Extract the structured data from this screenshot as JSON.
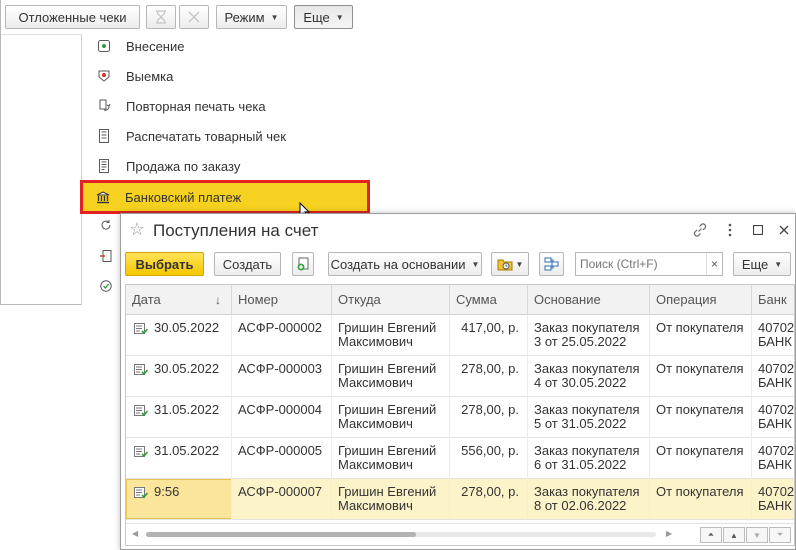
{
  "back_window": {
    "toolbar": {
      "deferred_checks": "Отложенные чеки",
      "mode": "Режим",
      "more": "Еще"
    },
    "menu": {
      "items": [
        {
          "label": "Внесение",
          "icon": "cash-in-icon"
        },
        {
          "label": "Выемка",
          "icon": "cash-out-icon"
        },
        {
          "label": "Повторная печать чека",
          "icon": "reprint-icon"
        },
        {
          "label": "Распечатать товарный чек",
          "icon": "receipt-icon"
        },
        {
          "label": "Продажа по заказу",
          "icon": "order-sale-icon"
        },
        {
          "label": "Банковский платеж",
          "icon": "bank-icon",
          "highlighted": true
        }
      ]
    }
  },
  "front_window": {
    "title": "Поступления на счет",
    "toolbar": {
      "select": "Выбрать",
      "create": "Создать",
      "create_based_on": "Создать на основании",
      "search_placeholder": "Поиск (Ctrl+F)",
      "search_clear": "×",
      "more": "Еще"
    },
    "table": {
      "columns": [
        "Дата",
        "Номер",
        "Откуда",
        "Сумма",
        "Основание",
        "Операция",
        "Банк"
      ],
      "rows": [
        {
          "date": "30.05.2022",
          "number": "АСФР-000002",
          "from1": "Гришин Евгений",
          "from2": "Максимович",
          "sum": "417,00, р.",
          "basis1": "Заказ покупателя",
          "basis2": "3 от 25.05.2022",
          "operation": "От покупателя",
          "bank1": "40702",
          "bank2": "БАНК"
        },
        {
          "date": "30.05.2022",
          "number": "АСФР-000003",
          "from1": "Гришин Евгений",
          "from2": "Максимович",
          "sum": "278,00, р.",
          "basis1": "Заказ покупателя",
          "basis2": "4 от 30.05.2022",
          "operation": "От покупателя",
          "bank1": "40702",
          "bank2": "БАНК"
        },
        {
          "date": "31.05.2022",
          "number": "АСФР-000004",
          "from1": "Гришин Евгений",
          "from2": "Максимович",
          "sum": "278,00, р.",
          "basis1": "Заказ покупателя",
          "basis2": "5 от 31.05.2022",
          "operation": "От покупателя",
          "bank1": "40702",
          "bank2": "БАНК"
        },
        {
          "date": "31.05.2022",
          "number": "АСФР-000005",
          "from1": "Гришин Евгений",
          "from2": "Максимович",
          "sum": "556,00, р.",
          "basis1": "Заказ покупателя",
          "basis2": "6 от 31.05.2022",
          "operation": "От покупателя",
          "bank1": "40702",
          "bank2": "БАНК"
        },
        {
          "date": "9:56",
          "number": "АСФР-000007",
          "from1": "Гришин Евгений",
          "from2": "Максимович",
          "sum": "278,00, р.",
          "basis1": "Заказ покупателя",
          "basis2": "8 от 02.06.2022",
          "operation": "От покупателя",
          "bank1": "40702",
          "bank2": "БАНК",
          "selected": true
        }
      ]
    }
  }
}
